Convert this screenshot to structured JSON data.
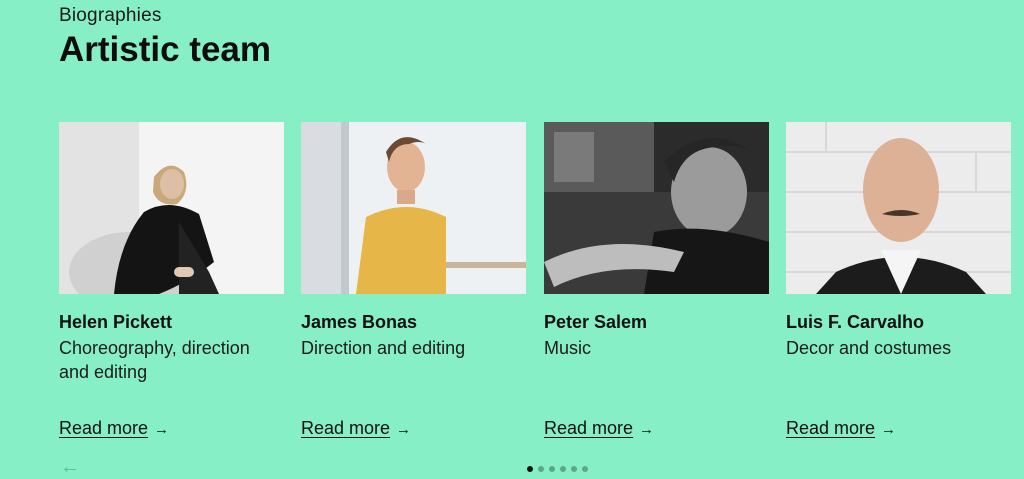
{
  "section": {
    "eyebrow": "Biographies",
    "title": "Artistic team"
  },
  "members": [
    {
      "name": "Helen Pickett",
      "role": "Choreography, direction and editing",
      "link": "Read more"
    },
    {
      "name": "James Bonas",
      "role": "Direction and editing",
      "link": "Read more"
    },
    {
      "name": "Peter Salem",
      "role": "Music",
      "link": "Read more"
    },
    {
      "name": "Luis F. Carvalho",
      "role": "Decor and costumes",
      "link": "Read more"
    }
  ],
  "icons": {
    "link_arrow": "arrow-right-icon",
    "prev_arrow": "arrow-left-icon"
  },
  "pagination": {
    "total": 6,
    "active": 0
  },
  "colors": {
    "background": "#86efc6",
    "text": "#111111"
  }
}
